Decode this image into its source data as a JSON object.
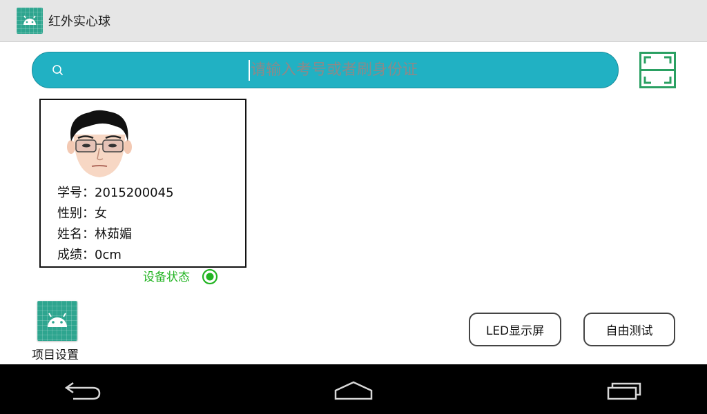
{
  "app": {
    "title": "红外实心球",
    "icon": "android-icon"
  },
  "search": {
    "placeholder": "请输入考号或者刷身份证",
    "value": "",
    "icon": "search-icon",
    "color": "#21b1c3"
  },
  "scan": {
    "icon": "scan-frame-icon",
    "color": "#2aa062"
  },
  "student": {
    "id_label": "学号：",
    "id": "2015200045",
    "gender_label": "性别：",
    "gender": "女",
    "name_label": "姓名：",
    "name": "林茹媚",
    "score_label": "成绩：",
    "score": "0cm",
    "avatar": "face-avatar"
  },
  "device": {
    "status_label": "设备状态",
    "status_color": "#22b422"
  },
  "project_settings": {
    "label": "项目设置",
    "icon": "android-icon"
  },
  "buttons": {
    "led": "LED显示屏",
    "free_test": "自由测试"
  },
  "navbar": {
    "back_icon": "back-icon",
    "home_icon": "home-icon",
    "recent_icon": "recent-apps-icon"
  }
}
